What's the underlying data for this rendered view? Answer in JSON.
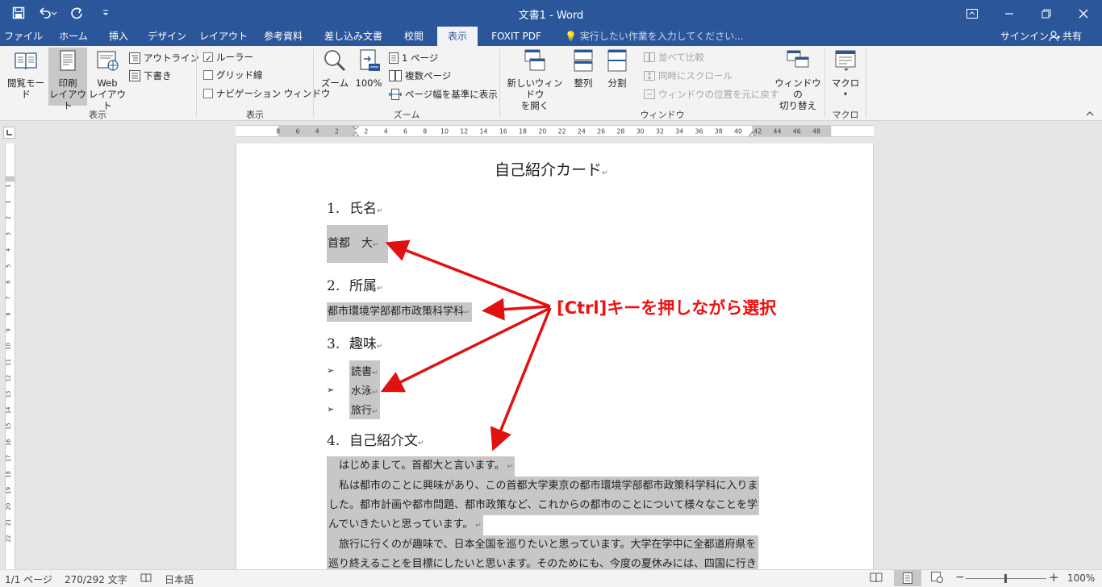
{
  "window": {
    "title": "文書1 - Word"
  },
  "tabs": [
    {
      "label": "ファイル"
    },
    {
      "label": "ホーム"
    },
    {
      "label": "挿入"
    },
    {
      "label": "デザイン"
    },
    {
      "label": "レイアウト"
    },
    {
      "label": "参考資料"
    },
    {
      "label": "差し込み文書"
    },
    {
      "label": "校閲"
    },
    {
      "label": "表示",
      "active": true
    },
    {
      "label": "FOXIT PDF"
    }
  ],
  "tellme": {
    "placeholder": "実行したい作業を入力してください..."
  },
  "account": {
    "signin": "サインイン",
    "share": "共有"
  },
  "ribbon": {
    "views": {
      "read_mode": "閲覧モード",
      "print_layout_1": "印刷",
      "print_layout_2": "レイアウト",
      "web_layout_1": "Web",
      "web_layout_2": "レイアウト",
      "outline": "アウトライン",
      "draft": "下書き",
      "group_label": "表示"
    },
    "show": {
      "ruler": "ルーラー",
      "gridlines": "グリッド線",
      "navigation": "ナビゲーション ウィンドウ",
      "group_label": "表示",
      "ruler_checked": true,
      "gridlines_checked": false,
      "navigation_checked": false
    },
    "zoom": {
      "zoom": "ズーム",
      "percent": "100%",
      "one_page": "1 ページ",
      "multi_page": "複数ページ",
      "page_width": "ページ幅を基準に表示",
      "group_label": "ズーム"
    },
    "window": {
      "new_window_1": "新しいウィンドウ",
      "new_window_2": "を開く",
      "arrange": "整列",
      "split": "分割",
      "side_by_side": "並べて比較",
      "sync_scroll": "同時にスクロール",
      "reset_position": "ウィンドウの位置を元に戻す",
      "switch_1": "ウィンドウの",
      "switch_2": "切り替え",
      "group_label": "ウィンドウ"
    },
    "macros": {
      "macro": "マクロ",
      "group_label": "マクロ"
    }
  },
  "hruler_ticks": [
    "8",
    "6",
    "4",
    "2",
    "2",
    "4",
    "6",
    "8",
    "10",
    "12",
    "14",
    "16",
    "18",
    "20",
    "22",
    "24",
    "26",
    "28",
    "30",
    "32",
    "34",
    "36",
    "38",
    "40",
    "42",
    "44",
    "46",
    "48"
  ],
  "vruler_ticks": [
    "1",
    "1",
    "2",
    "3",
    "4",
    "5",
    "6",
    "7",
    "8",
    "9",
    "10",
    "11",
    "12",
    "13",
    "14",
    "15",
    "16",
    "17",
    "18",
    "19",
    "20",
    "21",
    "22"
  ],
  "document": {
    "title": "自己紹介カード",
    "h1": {
      "num": "1.",
      "text": "氏名"
    },
    "name": "首都　大",
    "h2": {
      "num": "2.",
      "text": "所属"
    },
    "affiliation": "都市環境学部都市政策科学科",
    "h3": {
      "num": "3.",
      "text": "趣味"
    },
    "hobbies": [
      "読書",
      "水泳",
      "旅行"
    ],
    "h4": {
      "num": "4.",
      "text": "自己紹介文"
    },
    "para_lines": [
      "　はじめまして。首都大と言います。",
      "　私は都市のことに興味があり、この首都大学東京の都市環境学部都市政策科学科に入りま",
      "した。都市計画や都市問題、都市政策など、これからの都市のことについて様々なことを学",
      "んでいきたいと思っています。",
      "　旅行に行くのが趣味で、日本全国を巡りたいと思っています。大学在学中に全都道府県を",
      "巡り終えることを目標にしたいと思います。そのためにも、今度の夏休みには、四国に行き"
    ],
    "para_marks": [
      true,
      false,
      false,
      true,
      false,
      false
    ]
  },
  "annotation": "[Ctrl]キーを押しながら選択",
  "status": {
    "page": "1/1 ページ",
    "words": "270/292 文字",
    "language": "日本語",
    "zoom": "100%",
    "zoom_level": 1.0
  },
  "colors": {
    "brand": "#2b579a",
    "selection": "#c7c7c7",
    "annotation": "#e11111"
  }
}
